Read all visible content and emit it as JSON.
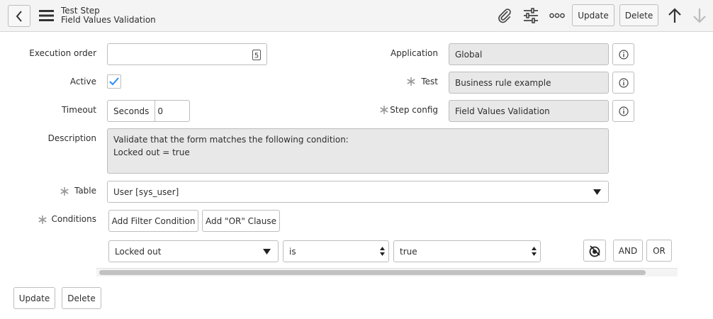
{
  "header": {
    "title": "Test Step",
    "subtitle": "Field Values Validation",
    "update_label": "Update",
    "delete_label": "Delete"
  },
  "form": {
    "execution_order": {
      "label": "Execution order",
      "value": ""
    },
    "active": {
      "label": "Active",
      "checked": true
    },
    "timeout": {
      "label": "Timeout",
      "unit": "Seconds",
      "value": "0"
    },
    "description": {
      "label": "Description",
      "line1": "Validate that the form matches the following condition:",
      "line2": "Locked out = true"
    },
    "application": {
      "label": "Application",
      "value": "Global"
    },
    "test": {
      "label": "Test",
      "value": "Business rule example"
    },
    "step_config": {
      "label": "Step config",
      "value": "Field Values Validation"
    },
    "table": {
      "label": "Table",
      "value": "User [sys_user]"
    },
    "conditions": {
      "label": "Conditions",
      "add_filter_label": "Add Filter Condition",
      "add_or_label": "Add \"OR\" Clause",
      "field": "Locked out",
      "operator": "is",
      "value": "true",
      "and_label": "AND",
      "or_label": "OR"
    }
  },
  "footer": {
    "update_label": "Update",
    "delete_label": "Delete"
  },
  "colors": {
    "header_bg": "#f4f4f4",
    "readonly_bg": "#e8e8e8",
    "accent": "#278efc",
    "border": "#bdbdbd"
  }
}
